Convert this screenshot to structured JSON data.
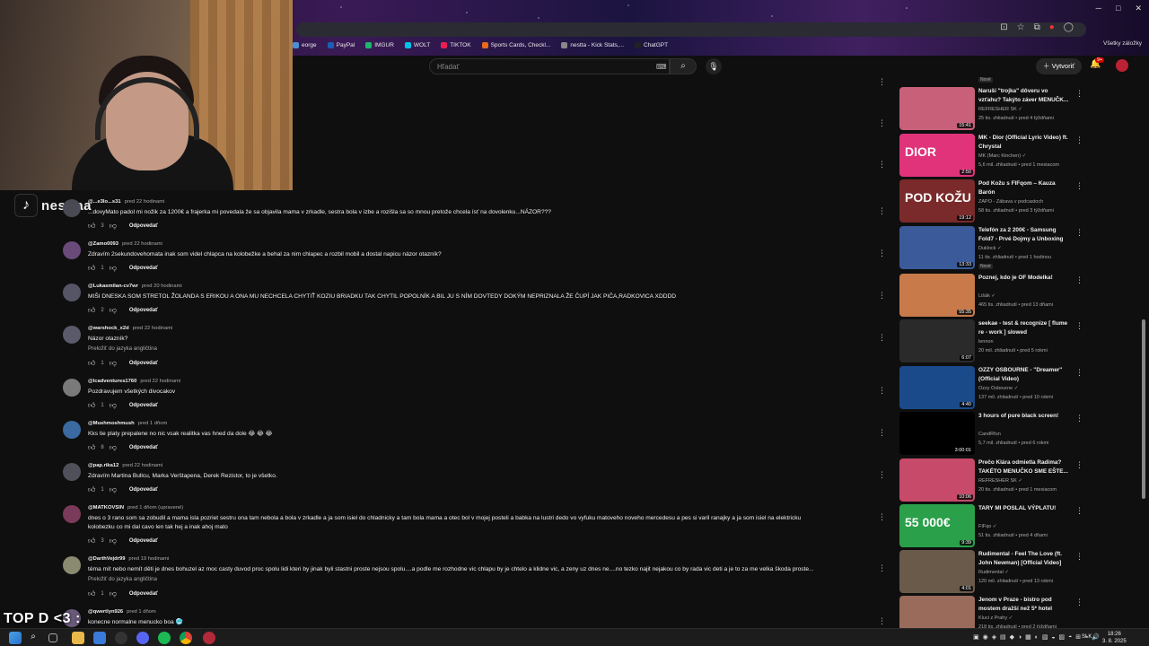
{
  "bookmarks": [
    {
      "label": "eorge",
      "color": "#4a90d9"
    },
    {
      "label": "PayPal",
      "color": "#1a5fb4"
    },
    {
      "label": "IMGUR",
      "color": "#1bb76e"
    },
    {
      "label": "WOLT",
      "color": "#00c2e8"
    },
    {
      "label": "TIKTOK",
      "color": "#ee1d52"
    },
    {
      "label": "Sports Cards, Checkl...",
      "color": "#e86a1c"
    },
    {
      "label": "nestta - Kick Stats,...",
      "color": "#888888"
    },
    {
      "label": "ChatGPT",
      "color": "#222222"
    }
  ],
  "all_bookmarks": "Všetky záložky",
  "search": {
    "placeholder": "Hľadať"
  },
  "header": {
    "create_label": "Vytvoriť",
    "notif_count": "9+"
  },
  "overlay": {
    "tiktok_name": "nesttaa",
    "bottom_text": "TOP D <3 :"
  },
  "reply_label": "Odpovedať",
  "translate_label": "Preložiť do jazyka angličtina",
  "comments": [
    {
      "user": "@...e3lo...s31",
      "time": "pred 22 hodinami",
      "text": "...dovyMato padol mi nožik za 1200€ a frajerka mi povedala že sa objavila mama v zrkadle, sestra bola v izbe a rozišla sa so mnou pretože chcela ísť na dovolenku...NÁZOR???",
      "likes": "3",
      "avatar": "#4a4a55"
    },
    {
      "user": "@Zamo0093",
      "time": "pred 22 hodinami",
      "text": "Zdravím 2sekundovehomata inak som videl chlapca na kolobežke a behal za nim chlapec a rozbil mobil a dostal napicu názor otazník?",
      "likes": "1",
      "avatar": "#6a4a7a"
    },
    {
      "user": "@Lukasmilan-cv7wr",
      "time": "pred 20 hodinami",
      "text": "MIŠI DNESKA SOM STRETOL ŽOLANDA S ERIKOU A ONA MU NECHCELA CHYTIŤ KOZIU BRIADKU TAK CHYTIL POPOLNÍK A BIL JU S NÍM DOVTEDY DOKÝM NEPRIZNALA ŽE ČUPÍ JAK PIČA,RADKOVICA XDDDD",
      "likes": "2",
      "avatar": "#555566"
    },
    {
      "user": "@warshock_x2d",
      "time": "pred 22 hodinami",
      "text": "Názor otazník?",
      "likes": "1",
      "avatar": "#5a5a6a",
      "translate": true
    },
    {
      "user": "@lcadventures1760",
      "time": "pred 22 hodinami",
      "text": "Pozdravujem všetkých divocakov",
      "likes": "1",
      "avatar": "#7a7a7a"
    },
    {
      "user": "@Mushmoshmush",
      "time": "pred 1 dňom",
      "text": "Kks tie platy prepalene no nic vsak realitka vas hned da dole 😂 😂 😂",
      "likes": "8",
      "avatar": "#3a6aa0"
    },
    {
      "user": "@pap.rika12",
      "time": "pred 22 hodinami",
      "text": "Zdravím Martina Bullcu, Marka Verštapena, Derek Rezistor, to je všetko.",
      "likes": "1",
      "avatar": "#50505a"
    },
    {
      "user": "@MATKOVSIN",
      "time": "pred 1 dňom (upravené)",
      "text": "dnes o 3 rano som sa zobudil a mama isla pozriet sestru ona tam nebola a bola v zrkadle a ja som isiel do chladnicky a tam bola mama a otec bol v mojej posteli a babka na lustri dedo vo vyfuku matoveho noveho mercedesu a pes si varil ranajky a ja som isiel na elektricku",
      "text2": "kolobezku co mi dal cavo len tak hej a inak ahoj mato",
      "likes": "3",
      "avatar": "#7a3a5a"
    },
    {
      "user": "@DarthVejdr99",
      "time": "pred 19 hodinami",
      "text": "téma mít nebo nemít děti je dnes bohuzel az moc casty duvod proc spolu lidi kteri by jinak byli stastni proste nejsou spolu....a podle me rozhodne vic chlapu by je chtelo a klidne vic, a zeny uz dnes ne....no tezko najit nejakou co by rada vic deti a je to za me velka škoda proste...",
      "likes": "1",
      "avatar": "#8a8a70",
      "translate": true
    },
    {
      "user": "@qwertlyn926",
      "time": "pred 1 dňom",
      "text": "konecne normalne menucko boa 🥶",
      "likes": "",
      "avatar": "#6a5a7a"
    }
  ],
  "sidebar": [
    {
      "title": "",
      "channel": "",
      "meta": "",
      "duration": "",
      "new": "Nové",
      "thumb": "#444"
    },
    {
      "title": "Naruší \"trojka\" dôveru vo vzťahu? Takýto záver MENUČK...",
      "channel": "REFRESHER SK ✓",
      "meta": "25 tis. zhliadnutí • pred 4 týždňami",
      "duration": "15:41",
      "thumb": "#c8607a"
    },
    {
      "title": "MK - Dior (Official Lyric Video) ft. Chrystal",
      "channel": "MK (Marc Kinchen) ✓",
      "meta": "5,6 mil. zhliadnutí • pred 1 mesiacom",
      "duration": "2:50",
      "thumb": "#e0337a",
      "thumb_text": "DIOR"
    },
    {
      "title": "Pod Kožu s FIFqom – Kauza Barón",
      "channel": "ZAPO - Zábava v podcastoch",
      "meta": "58 tis. zhliadnutí • pred 3 týždňami",
      "duration": "19:12",
      "thumb": "#7a2a2a",
      "thumb_text": "POD KOŽU"
    },
    {
      "title": "Telefón za 2 200€ - Samsung Fold7 - Prvé Dojmy a Unboxing",
      "channel": "Duklock ✓",
      "meta": "11 tis. zhliadnutí • pred 1 hodinou",
      "duration": "13:33",
      "new": "Nové",
      "thumb": "#3a5a9a"
    },
    {
      "title": "Poznej, kdo je OF Modelka!",
      "channel": "Lišák ✓",
      "meta": "465 tis. zhliadnutí • pred 13 dňami",
      "duration": "55:35",
      "thumb": "#c87a4a"
    },
    {
      "title": "seekae - test & recognize [ flume re - work ] slowed",
      "channel": "lennon",
      "meta": "20 mil. zhliadnutí • pred 5 rokmi",
      "duration": "6:07",
      "thumb": "#2a2a2a"
    },
    {
      "title": "OZZY OSBOURNE - \"Dreamer\" (Official Video)",
      "channel": "Ozzy Osbourne ✓",
      "meta": "137 mil. zhliadnutí • pred 10 rokmi",
      "duration": "4:40",
      "thumb": "#1a4a8a"
    },
    {
      "title": "3 hours of pure black screen!",
      "channel": "CandRfun",
      "meta": "5,7 mil. zhliadnutí • pred 6 rokmi",
      "duration": "3:00:01",
      "thumb": "#000000"
    },
    {
      "title": "Prečo Klára odmietla Radima? TAKÉTO MENUČKO SME EŠTE...",
      "channel": "REFRESHER SK ✓",
      "meta": "20 tis. zhliadnutí • pred 1 mesiacom",
      "duration": "10:06",
      "thumb": "#c84a6a"
    },
    {
      "title": "TARY MI POSLAL VÝPLATU!",
      "channel": "FIFqo ✓",
      "meta": "51 tis. zhliadnutí • pred 4 dňami",
      "duration": "9:39",
      "thumb": "#2aa04a",
      "thumb_text": "55 000€"
    },
    {
      "title": "Rudimental - Feel The Love (ft. John Newman) [Official Video]",
      "channel": "Rudimental ✓",
      "meta": "120 mil. zhliadnutí • pred 13 rokmi",
      "duration": "4:01",
      "thumb": "#6a5a4a"
    },
    {
      "title": "Jenom v Praze - bistro pod mostem dražší než 5* hotel",
      "channel": "Kluci z Prahy ✓",
      "meta": "218 tis. zhliadnutí • pred 2 týždňami",
      "duration": "",
      "thumb": "#9a6a5a"
    }
  ],
  "taskbar": {
    "lang": "SLK",
    "time": "18:26",
    "date": "3. 8. 2025"
  }
}
